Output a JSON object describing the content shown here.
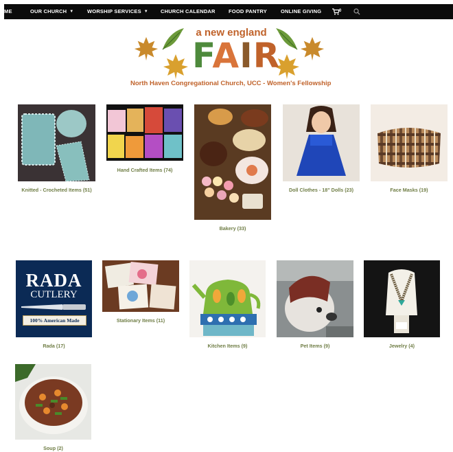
{
  "nav": {
    "items": [
      {
        "label": "ME",
        "has_dropdown": false
      },
      {
        "label": "OUR CHURCH",
        "has_dropdown": true
      },
      {
        "label": "WORSHIP SERVICES",
        "has_dropdown": true
      },
      {
        "label": "CHURCH CALENDAR",
        "has_dropdown": false
      },
      {
        "label": "FOOD PANTRY",
        "has_dropdown": false
      },
      {
        "label": "ONLINE GIVING",
        "has_dropdown": false
      }
    ],
    "cart_count": "0",
    "cart_icon": "cart-icon",
    "search_icon": "search-icon"
  },
  "logo": {
    "line1": "a new england",
    "fair": "FAIR",
    "subtitle": "North Haven Congregational Church, UCC - Women's Fellowship",
    "colors": {
      "orange": "#d9743a",
      "green": "#4e8a3c",
      "brown": "#8a5a2b"
    }
  },
  "categories": [
    {
      "label": "Knitted - Crocheted Items (51)"
    },
    {
      "label": "Hand Crafted Items (74)"
    },
    {
      "label": "Bakery (33)"
    },
    {
      "label": "Doll Clothes - 18\" Dolls (23)"
    },
    {
      "label": "Face Masks (19)"
    },
    {
      "label": "Rada (17)",
      "image_text": {
        "brand": "RADA",
        "sub": "CUTLERY",
        "banner": "100% American Made"
      }
    },
    {
      "label": "Stationary Items (11)"
    },
    {
      "label": "Kitchen Items (9)"
    },
    {
      "label": "Pet Items (9)"
    },
    {
      "label": "Jewelry (4)"
    },
    {
      "label": "Soup (2)"
    }
  ],
  "colors": {
    "label": "#6f7d45",
    "nav_bg": "#0b0b0b"
  }
}
